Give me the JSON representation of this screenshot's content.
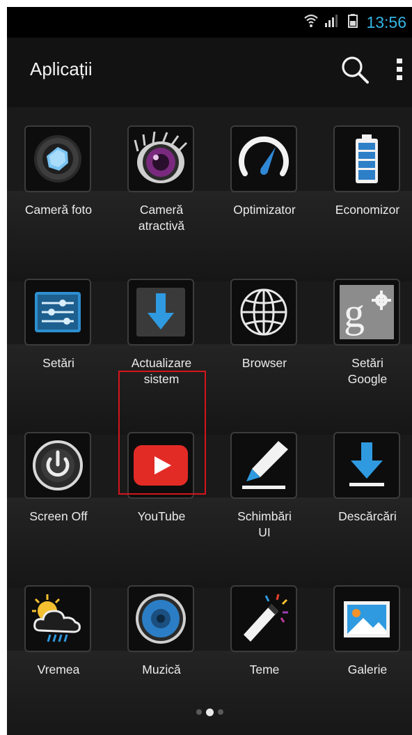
{
  "status_bar": {
    "time": "13:56",
    "icons": [
      "wifi-icon",
      "signal-icon",
      "battery-icon"
    ],
    "time_color": "#33b5e5"
  },
  "action_bar": {
    "title": "Aplicații",
    "actions": [
      "search-icon",
      "overflow-menu-icon"
    ]
  },
  "apps": [
    {
      "label": "Cameră foto",
      "icon": "camera-icon"
    },
    {
      "label": "Cameră\natractivă",
      "icon": "beauty-camera-icon"
    },
    {
      "label": "Optimizator",
      "icon": "speedometer-icon"
    },
    {
      "label": "Economizor",
      "icon": "battery-saver-icon"
    },
    {
      "label": "Setări",
      "icon": "settings-sliders-icon"
    },
    {
      "label": "Actualizare\nsistem",
      "icon": "system-update-icon",
      "highlighted": true
    },
    {
      "label": "Browser",
      "icon": "globe-icon"
    },
    {
      "label": "Setări\nGoogle",
      "icon": "google-settings-icon"
    },
    {
      "label": "Screen Off",
      "icon": "power-icon"
    },
    {
      "label": "YouTube",
      "icon": "youtube-icon"
    },
    {
      "label": "Schimbări\nUI",
      "icon": "brush-icon"
    },
    {
      "label": "Descărcări",
      "icon": "download-icon"
    },
    {
      "label": "Vremea",
      "icon": "weather-icon"
    },
    {
      "label": "Muzică",
      "icon": "speaker-icon"
    },
    {
      "label": "Teme",
      "icon": "magic-wand-icon"
    },
    {
      "label": "Galerie",
      "icon": "gallery-icon"
    }
  ],
  "pager": {
    "pages": 3,
    "current": 2
  },
  "highlight_color": "#d4151b"
}
